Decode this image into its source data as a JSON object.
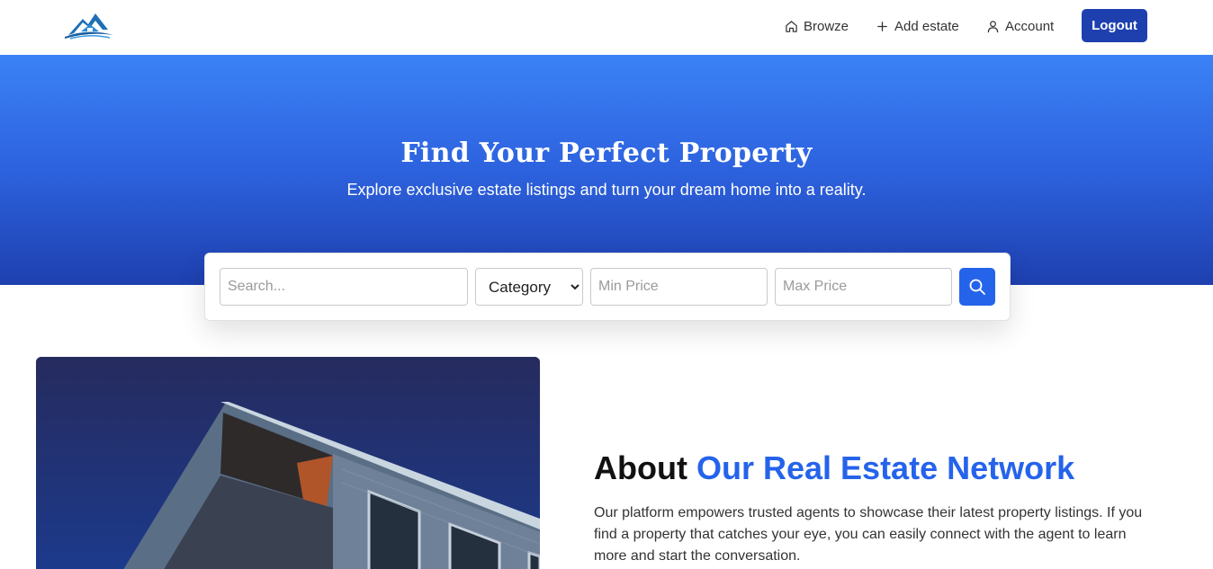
{
  "nav": {
    "links": [
      {
        "label": "Browze",
        "icon": "home-icon"
      },
      {
        "label": "Add estate",
        "icon": "plus-icon"
      },
      {
        "label": "Account",
        "icon": "user-icon"
      }
    ],
    "logout_label": "Logout",
    "logo_icon": "mountain-house-logo"
  },
  "hero": {
    "title": "Find Your Perfect Property",
    "subtitle": "Explore exclusive estate listings and turn your dream home into a reality."
  },
  "search": {
    "search_placeholder": "Search...",
    "category_selected": "Category",
    "min_price_placeholder": "Min Price",
    "max_price_placeholder": "Max Price",
    "button_icon": "search-icon"
  },
  "about": {
    "heading_plain": "About",
    "heading_accent": "Our Real Estate Network",
    "text": "Our platform empowers trusted agents to showcase their latest property listings. If you find a property that catches your eye, you can easily connect with the agent to learn more and start the conversation."
  },
  "colors": {
    "primary": "#2563eb",
    "primary_dark": "#1e40af",
    "hero_top": "#3b82f6"
  }
}
